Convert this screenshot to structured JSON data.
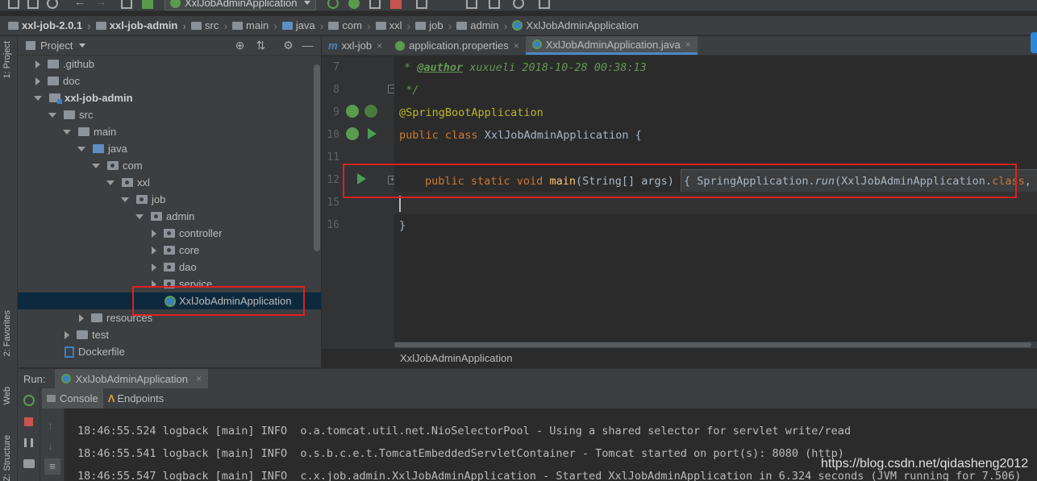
{
  "toolbar": {
    "run_config": "XxlJobAdminApplication"
  },
  "breadcrumbs": [
    "xxl-job-2.0.1",
    "xxl-job-admin",
    "src",
    "main",
    "java",
    "com",
    "xxl",
    "job",
    "admin",
    "XxlJobAdminApplication"
  ],
  "left_strip": {
    "project": "1: Project",
    "favorites": "2: Favorites",
    "web": "Web",
    "structure": "Z: Structure"
  },
  "project_panel": {
    "title": "Project",
    "tree": [
      {
        "label": ".github",
        "depth": 1,
        "expanded": false,
        "type": "folder"
      },
      {
        "label": "doc",
        "depth": 1,
        "expanded": false,
        "type": "folder"
      },
      {
        "label": "xxl-job-admin",
        "depth": 1,
        "expanded": true,
        "type": "module",
        "bold": true
      },
      {
        "label": "src",
        "depth": 2,
        "expanded": true,
        "type": "folder"
      },
      {
        "label": "main",
        "depth": 3,
        "expanded": true,
        "type": "folder"
      },
      {
        "label": "java",
        "depth": 4,
        "expanded": true,
        "type": "src"
      },
      {
        "label": "com",
        "depth": 5,
        "expanded": true,
        "type": "package"
      },
      {
        "label": "xxl",
        "depth": 6,
        "expanded": true,
        "type": "package"
      },
      {
        "label": "job",
        "depth": 7,
        "expanded": true,
        "type": "package"
      },
      {
        "label": "admin",
        "depth": 8,
        "expanded": true,
        "type": "package"
      },
      {
        "label": "controller",
        "depth": 9,
        "expanded": false,
        "type": "package"
      },
      {
        "label": "core",
        "depth": 9,
        "expanded": false,
        "type": "package"
      },
      {
        "label": "dao",
        "depth": 9,
        "expanded": false,
        "type": "package"
      },
      {
        "label": "service",
        "depth": 9,
        "expanded": false,
        "type": "package"
      },
      {
        "label": "XxlJobAdminApplication",
        "depth": 9,
        "type": "class",
        "selected": true
      },
      {
        "label": "resources",
        "depth": 4,
        "expanded": false,
        "type": "resources"
      },
      {
        "label": "test",
        "depth": 3,
        "expanded": false,
        "type": "folder"
      },
      {
        "label": "Dockerfile",
        "depth": 3,
        "type": "docker"
      }
    ]
  },
  "editor_tabs": [
    {
      "label": "xxl-job",
      "icon": "m-icon",
      "active": false
    },
    {
      "label": "application.properties",
      "icon": "spring-icon",
      "active": false
    },
    {
      "label": "XxlJobAdminApplication.java",
      "icon": "class-icon",
      "active": true
    }
  ],
  "editor": {
    "line_numbers": [
      "7",
      "8",
      "9",
      "10",
      "11",
      "12",
      "15",
      "16"
    ],
    "author_tag": "@author",
    "author_text": " xuxueli 2018-10-28 00:38:13",
    "doc_end": " */",
    "annotation": "@SpringBootApplication",
    "class_kw1": "public",
    "class_kw2": "class",
    "class_name": " XxlJobAdminApplication {",
    "main_kw": "public static void",
    "main_fn": "main",
    "main_args": "(String[] args)",
    "fold_open": "{",
    "fold_call_obj": " SpringApplication.",
    "fold_call_fn": "run",
    "fold_call_arg": "(XxlJobAdminApplication.",
    "fold_class_kw": "class",
    "fold_rest": ", ar",
    "closing": "}"
  },
  "editor_breadcrumb": "XxlJobAdminApplication",
  "run_panel": {
    "label": "Run:",
    "tab": "XxlJobAdminApplication",
    "subtabs": [
      "Console",
      "Endpoints"
    ],
    "log_lines": [
      "18:46:55.524 logback [main] INFO  o.a.tomcat.util.net.NioSelectorPool - Using a shared selector for servlet write/read",
      "18:46:55.541 logback [main] INFO  o.s.b.c.e.t.TomcatEmbeddedServletContainer - Tomcat started on port(s): 8080 (http)",
      "18:46:55.547 logback [main] INFO  c.x.job.admin.XxlJobAdminApplication - Started XxlJobAdminApplication in 6.324 seconds (JVM running for 7.506)"
    ]
  },
  "watermark": "https://blog.csdn.net/qidasheng2012",
  "colors": {
    "highlight_box": "#e02020",
    "selection": "#0d293e",
    "keyword": "#cc7832",
    "annotation": "#bbb529",
    "doc_comment": "#629755",
    "function": "#ffc66d"
  }
}
